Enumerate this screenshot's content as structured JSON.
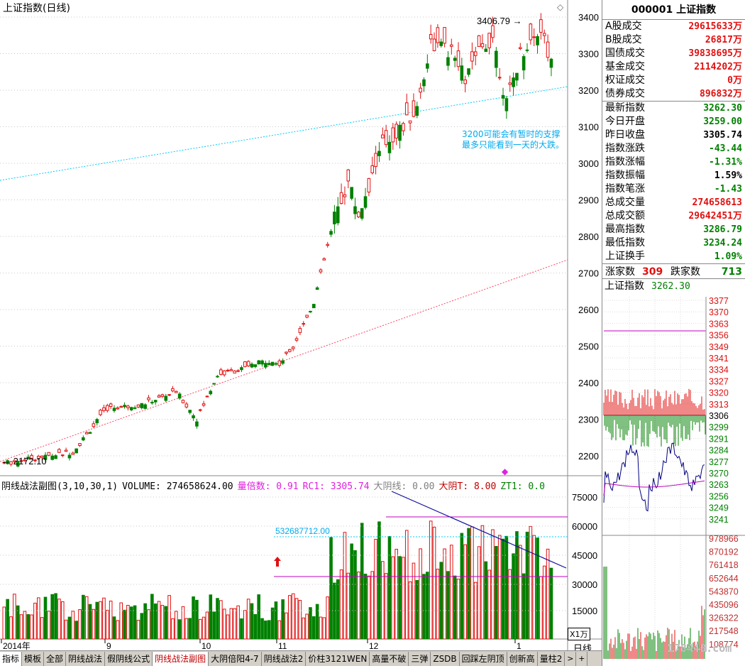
{
  "main": {
    "title": "上证指数(日线)",
    "high_label": "3406.79",
    "low_label": "2172.10",
    "annotation_line1": "3200可能会有暂时的支撑",
    "annotation_line2": "最多只能看到一天的大跌。",
    "price_axis": [
      "3400",
      "3300",
      "3200",
      "3100",
      "3000",
      "2900",
      "2800",
      "2700",
      "2600",
      "2500",
      "2400",
      "2300",
      "2200"
    ],
    "colors": {
      "up": "#e01010",
      "down": "#008000",
      "trend_upper": "#00ccff",
      "trend_lower": "#ff4466"
    }
  },
  "sub": {
    "name": "阴线战法副图(3,10,30,1)",
    "volume_label": "VOLUME: 274658624.00",
    "ratio_label": "量倍数: 0.91",
    "rc1_label": "RC1: 3305.74",
    "big_yin_label": "大阴线: 0.00",
    "big_yin_t_label": "大阴T: 8.00",
    "zt1_label": "ZT1: 0.0",
    "level_label": "532687712.00",
    "volume_axis": [
      "75000",
      "60000",
      "45000",
      "30000",
      "15000"
    ],
    "unit_label": "X1万"
  },
  "time_axis": [
    "2014年",
    "9",
    "10",
    "11",
    "12",
    "1"
  ],
  "period_label": "日线",
  "quote": {
    "code": "000001",
    "name": "上证指数",
    "rows_a": [
      {
        "label": "A股成交",
        "value": "29615633万",
        "color": "red"
      },
      {
        "label": "B股成交",
        "value": "26817万",
        "color": "red"
      },
      {
        "label": "国债成交",
        "value": "39838695万",
        "color": "red"
      },
      {
        "label": "基金成交",
        "value": "2114202万",
        "color": "red"
      },
      {
        "label": "权证成交",
        "value": "0万",
        "color": "red"
      },
      {
        "label": "债券成交",
        "value": "896832万",
        "color": "red"
      }
    ],
    "rows_b": [
      {
        "label": "最新指数",
        "value": "3262.30",
        "color": "green"
      },
      {
        "label": "今日开盘",
        "value": "3259.00",
        "color": "green"
      },
      {
        "label": "昨日收盘",
        "value": "3305.74",
        "color": "black"
      },
      {
        "label": "指数涨跌",
        "value": "-43.44",
        "color": "green"
      },
      {
        "label": "指数涨幅",
        "value": "-1.31%",
        "color": "green"
      },
      {
        "label": "指数振幅",
        "value": "1.59%",
        "color": "black"
      },
      {
        "label": "指数笔涨",
        "value": "-1.43",
        "color": "green"
      },
      {
        "label": "总成交量",
        "value": "274658613",
        "color": "red"
      },
      {
        "label": "总成交额",
        "value": "29642451万",
        "color": "red"
      },
      {
        "label": "最高指数",
        "value": "3286.79",
        "color": "green"
      },
      {
        "label": "最低指数",
        "value": "3234.24",
        "color": "green"
      },
      {
        "label": "上证换手",
        "value": "1.09%",
        "color": "green"
      }
    ],
    "up_label": "涨家数",
    "up_count": "309",
    "down_label": "跌家数",
    "down_count": "713"
  },
  "mini": {
    "title": "上证指数",
    "value": "3262.30",
    "price_axis": [
      "3377",
      "3370",
      "3363",
      "3356",
      "3349",
      "3341",
      "3334",
      "3327",
      "3320",
      "3313",
      "3306",
      "3299",
      "3291",
      "3284",
      "3277",
      "3270",
      "3263",
      "3256",
      "3249",
      "3241"
    ],
    "vol_axis": [
      "978966",
      "870192",
      "761418",
      "652644",
      "543870",
      "435096",
      "326322",
      "217548",
      "108774"
    ]
  },
  "tabs": [
    "指标",
    "模板",
    "全部",
    "阴线战法",
    "假阴线公式",
    "阴线战法副图",
    "大阴倍阳4-7",
    "阴线战法2",
    "价柱3121WEN",
    "高量不破",
    "三弹",
    "ZSDB",
    "回踩左阴顶",
    "创新高",
    "量柱2"
  ],
  "active_tab": "阴线战法副图",
  "watermark": "178448.com"
}
